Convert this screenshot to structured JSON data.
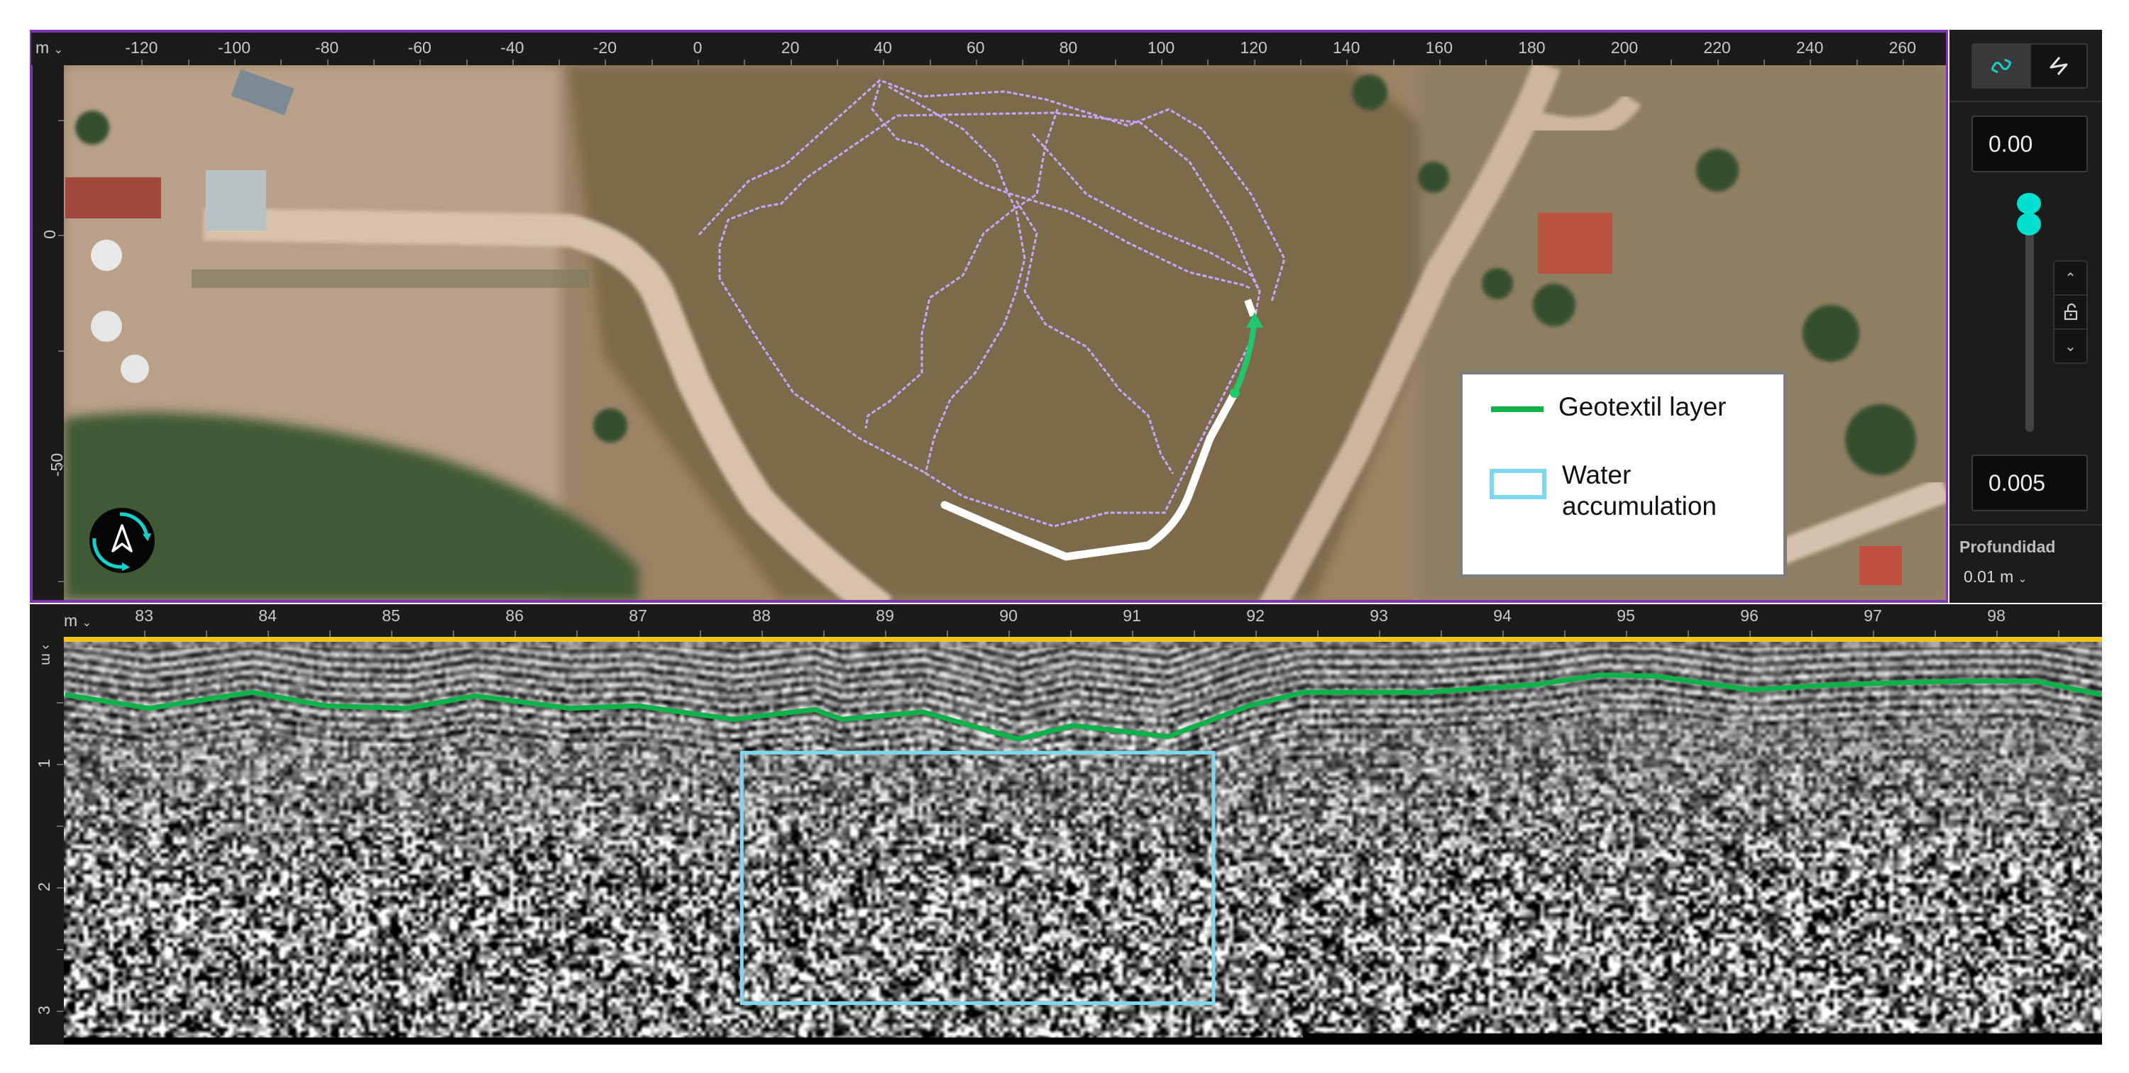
{
  "map": {
    "unit_selector": "m",
    "x_axis_labels": [
      "-120",
      "-100",
      "-80",
      "-60",
      "-40",
      "-20",
      "0",
      "20",
      "40",
      "60",
      "80",
      "100",
      "120",
      "140",
      "160",
      "180",
      "200",
      "220",
      "240",
      "260"
    ],
    "y_axis_labels": [
      "0",
      "-50"
    ],
    "compass_icon": "compass-north-rotate-icon",
    "track_colors": {
      "survey_lines": "#c9a6ff",
      "selected_line": "#ffffff",
      "current_profile": "#1fc86a"
    }
  },
  "legend": {
    "items": [
      {
        "label": "Geotextil layer",
        "color": "#0fb14a",
        "symbol": "line"
      },
      {
        "label": "Water accumulation",
        "label_line1": "Water",
        "label_line2": "accumulation",
        "color": "#7dd8ee",
        "symbol": "rectangle"
      }
    ]
  },
  "right_panel": {
    "mode_buttons": [
      {
        "name": "wave-mode-1",
        "icon": "signal-wave-icon",
        "active": true
      },
      {
        "name": "wave-mode-2",
        "icon": "signal-wave-alt-icon",
        "active": false
      }
    ],
    "max_value": "0.00",
    "min_value": "0.005",
    "slider_accent": "#00e0d0",
    "stepper": {
      "up": "chevron-up-icon",
      "lock": "unlock-icon",
      "down": "chevron-down-icon"
    },
    "depth_label": "Profundidad",
    "depth_value": "0.01 m"
  },
  "radargram": {
    "unit_selector": "m",
    "depth_unit": "m",
    "x_axis_labels": [
      "83",
      "84",
      "85",
      "86",
      "87",
      "88",
      "89",
      "90",
      "91",
      "92",
      "93",
      "94",
      "95",
      "96",
      "97",
      "98"
    ],
    "depth_labels": [
      "1",
      "2",
      "3"
    ],
    "highlight_color": "#f5c518"
  },
  "chart_data": {
    "type": "line",
    "xlabel": "m",
    "ylabel": "m",
    "xlim": [
      82.35,
      98.85
    ],
    "ylim": [
      0,
      3.27
    ],
    "series": [
      {
        "name": "Geotextil layer",
        "color": "#0fb14a",
        "x": [
          82.36,
          83.04,
          83.87,
          84.47,
          85.13,
          85.68,
          86.45,
          87.0,
          87.77,
          88.43,
          88.65,
          89.31,
          90.08,
          90.52,
          91.29,
          91.95,
          92.39,
          93.38,
          94.26,
          94.8,
          95.24,
          96.02,
          96.68,
          97.67,
          98.32,
          98.85
        ],
        "y": [
          0.44,
          0.55,
          0.42,
          0.53,
          0.55,
          0.45,
          0.55,
          0.53,
          0.64,
          0.56,
          0.64,
          0.58,
          0.8,
          0.69,
          0.78,
          0.53,
          0.42,
          0.42,
          0.36,
          0.28,
          0.29,
          0.4,
          0.36,
          0.33,
          0.33,
          0.44
        ]
      }
    ],
    "annotations": [
      {
        "name": "Water accumulation",
        "color": "#7dd8ee",
        "x_range": [
          87.84,
          91.66
        ],
        "depth_range": [
          0.91,
          2.94
        ]
      }
    ]
  }
}
